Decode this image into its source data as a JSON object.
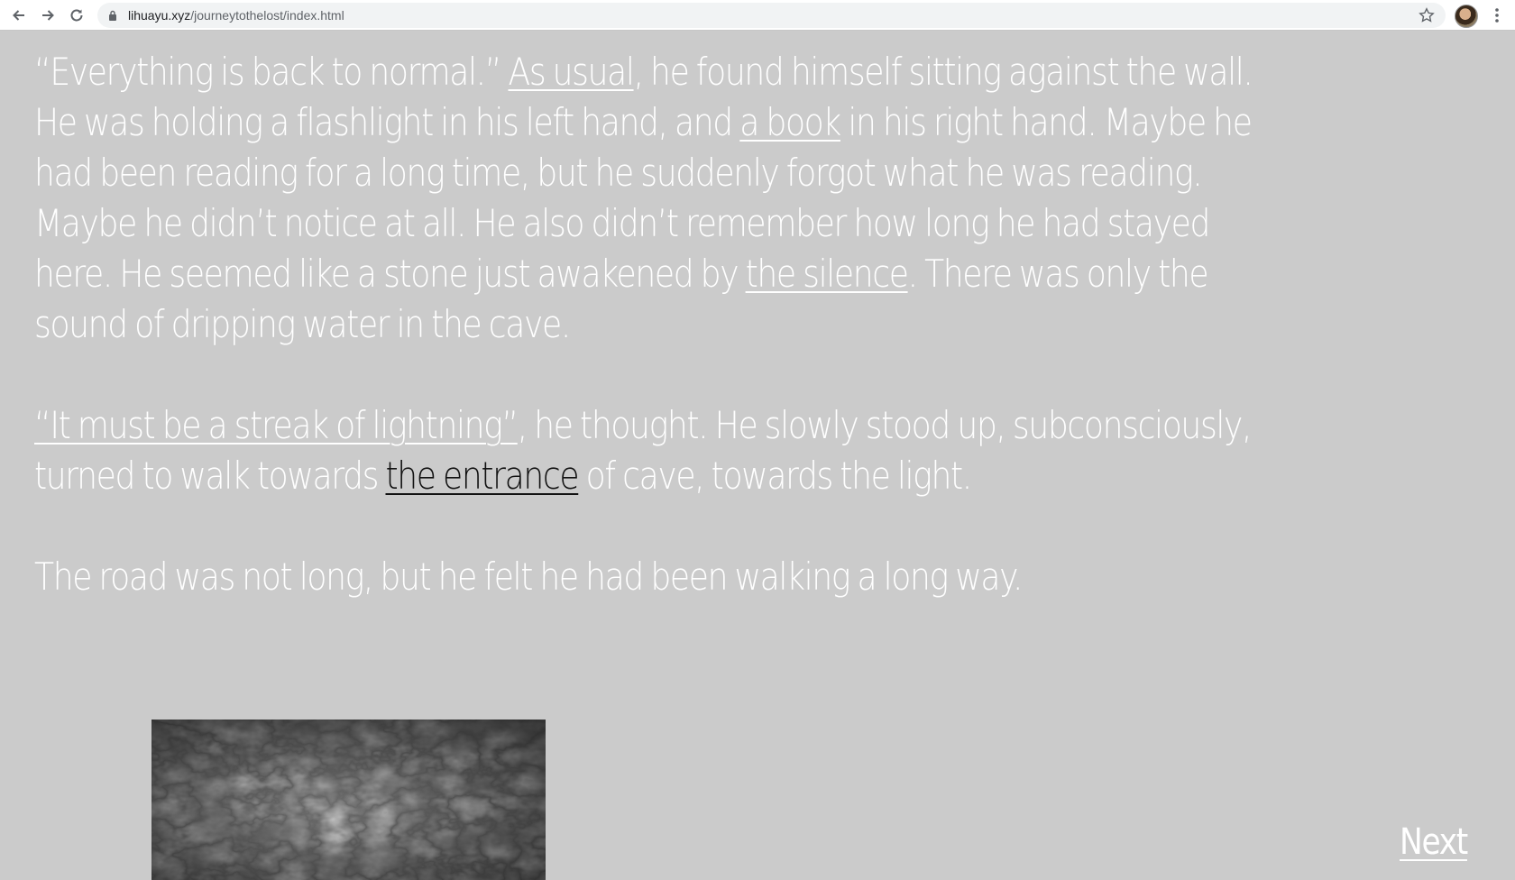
{
  "browser": {
    "url_host": "lihuayu.xyz",
    "url_path": "/journeytothelost/index.html"
  },
  "story": {
    "p1": {
      "s1": "“Everything is back to normal.” ",
      "link_as_usual": "As usual",
      "s2": ", he found himself sitting against the wall. He was holding a flashlight in his left hand, and ",
      "link_a_book": "a book",
      "s3": " in his right hand. Maybe he had been reading for a long time, but he suddenly forgot what he was reading. Maybe he didn’t notice at all. He also didn’t remember how long he had stayed here. He seemed like a stone just awakened by ",
      "link_the_silence": "the silence",
      "s4": ". There was only the sound of dripping water in the cave."
    },
    "p2": {
      "link_lightning": "“It must be a streak of lightning”",
      "s1": ", he thought. He slowly stood up, subconsciously, turned to walk towards ",
      "link_entrance": "the entrance",
      "s2": " of cave, towards the light."
    },
    "p3": "The road was not long, but he felt he had been walking a long way."
  },
  "next_label": "Next"
}
